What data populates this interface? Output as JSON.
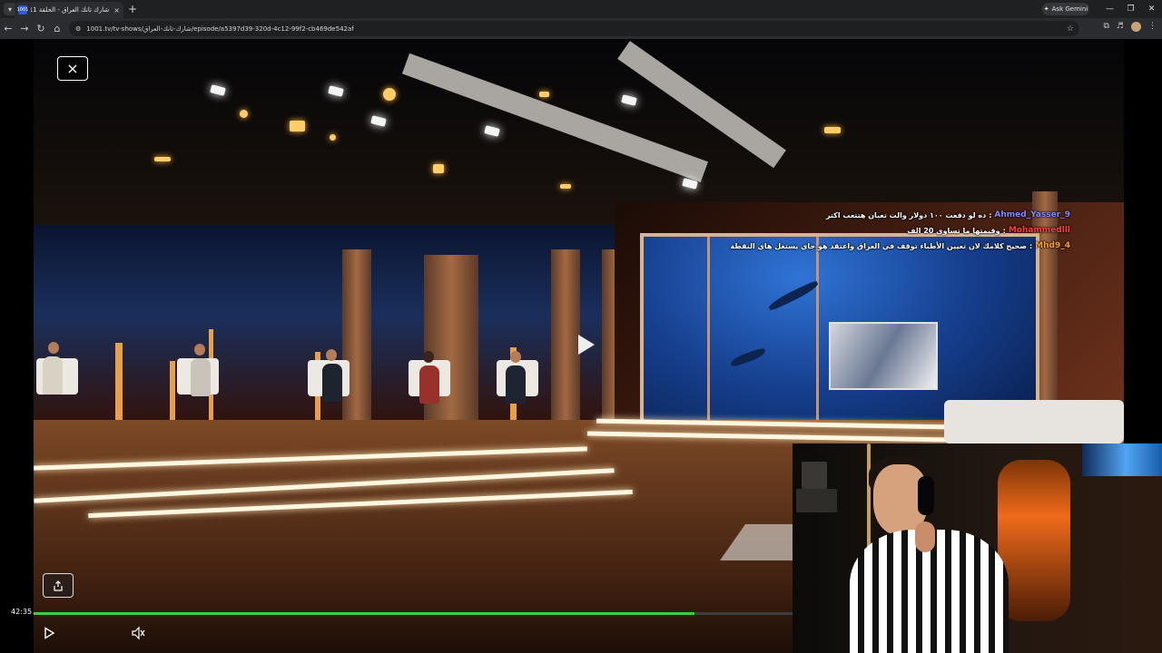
{
  "browser": {
    "tab_title": "شارك تانك العراق - الحلقة 11",
    "favicon_text": "1001",
    "new_tab_label": "+",
    "tab_close_label": "×",
    "ask_gemini_label": "Ask Gemini",
    "address": "1001.tv/tv-shows/شارك-تانك-العراق/episode/a5397d39-320d-4c12-99f2-cb469de542af"
  },
  "player": {
    "elapsed_time": "42:35",
    "progress_percent": 87,
    "center_play_label": "play",
    "close_label": "×"
  },
  "chat": {
    "messages": [
      {
        "user": "Ahmed_Yasser_9",
        "user_color": "#7d8cff",
        "text": "ده لو دفعت ١٠٠ دولار والت تعبان هتتعب اكتر"
      },
      {
        "user": "Mohammedlll",
        "user_color": "#ff3d3d",
        "text": "وقيمتها ما تساوي 20 الف"
      },
      {
        "user": "Mhd9_4",
        "user_color": "#ff9e2c",
        "text": "صحيح كلامك لان تعيين الأطباء توقف في العراق واعتقد هو جاي يستغل هاي النقطة"
      }
    ]
  },
  "colors": {
    "progress_fill": "#37cf43",
    "browser_bg": "#1f2022"
  },
  "icons": [
    "tab-menu-icon",
    "close-tab-icon",
    "new-tab-icon",
    "gemini-icon",
    "minimize-icon",
    "restore-icon",
    "close-window-icon",
    "back-icon",
    "forward-icon",
    "reload-icon",
    "home-icon",
    "site-info-icon",
    "bookmark-star-icon",
    "extensions-icon",
    "media-icon",
    "profile-avatar",
    "more-icon",
    "close-icon",
    "share-icon",
    "play-icon",
    "volume-icon"
  ]
}
